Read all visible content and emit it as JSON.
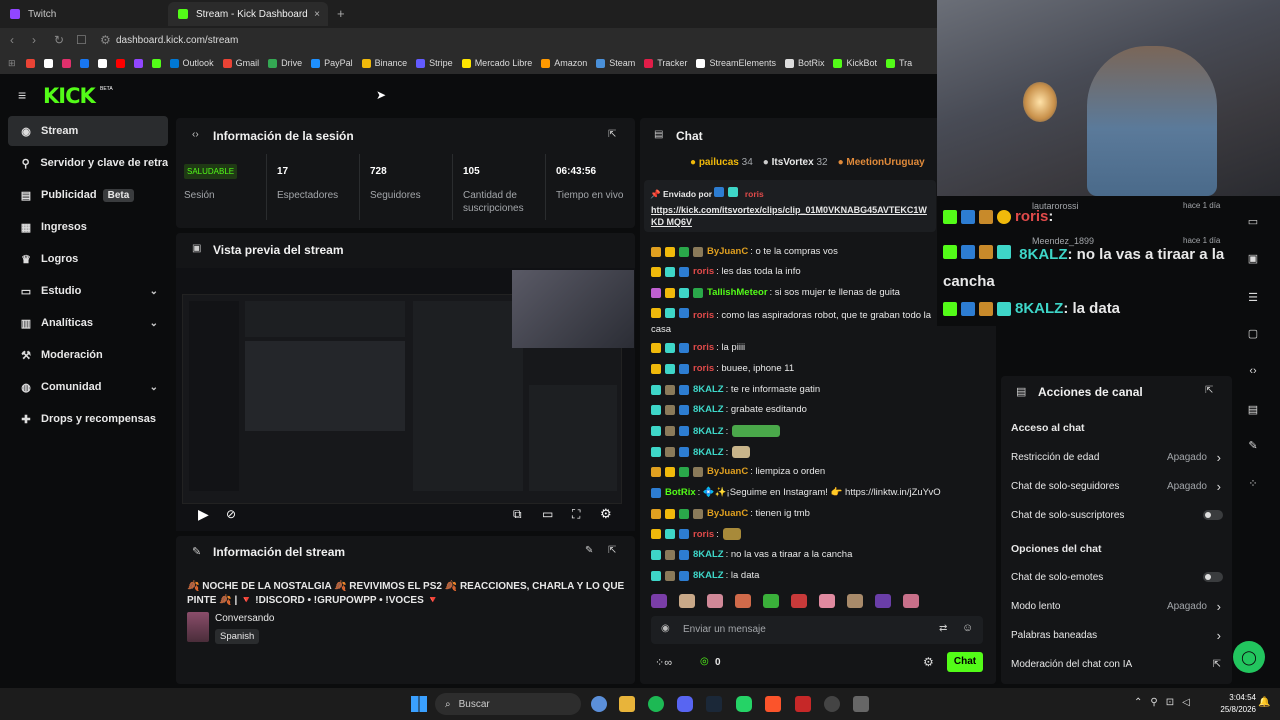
{
  "browser": {
    "tabs": [
      {
        "label": "Twitch",
        "color": "#9146ff"
      },
      {
        "label": "Stream - Kick Dashboard",
        "color": "#53fc18"
      }
    ],
    "new_tab": "+",
    "close": "×",
    "url": "dashboard.kick.com/stream",
    "bookmarks": [
      {
        "label": "",
        "color": "#ea4335"
      },
      {
        "label": "",
        "color": "#ffffff"
      },
      {
        "label": "",
        "color": "#e1306c"
      },
      {
        "label": "",
        "color": "#1877f2"
      },
      {
        "label": "",
        "color": "#ffffff"
      },
      {
        "label": "",
        "color": "#ff0000"
      },
      {
        "label": "",
        "color": "#9146ff"
      },
      {
        "label": "",
        "color": "#53fc18"
      },
      {
        "label": "Outlook",
        "color": "#0078d4"
      },
      {
        "label": "Gmail",
        "color": "#ea4335"
      },
      {
        "label": "Drive",
        "color": "#34a853"
      },
      {
        "label": "PayPal",
        "color": "#1e90ff"
      },
      {
        "label": "Binance",
        "color": "#f0b90b"
      },
      {
        "label": "Stripe",
        "color": "#635bff"
      },
      {
        "label": "Mercado Libre",
        "color": "#ffe600"
      },
      {
        "label": "Amazon",
        "color": "#ff9900"
      },
      {
        "label": "Steam",
        "color": "#4a90d9"
      },
      {
        "label": "Tracker",
        "color": "#e11d48"
      },
      {
        "label": "StreamElements",
        "color": "#ffffff"
      },
      {
        "label": "BotRix",
        "color": "#dddddd"
      },
      {
        "label": "KickBot",
        "color": "#53fc18"
      },
      {
        "label": "Tra",
        "color": "#53fc18"
      }
    ]
  },
  "brand": {
    "logo": "KICK",
    "beta": "BETA",
    "accent": "#53fc18"
  },
  "sidebar": {
    "items": [
      {
        "label": "Stream",
        "icon": "broadcast-icon"
      },
      {
        "label": "Servidor y clave de retran",
        "icon": "key-icon"
      },
      {
        "label": "Publicidad",
        "icon": "ad-icon",
        "badge": "Beta"
      },
      {
        "label": "Ingresos",
        "icon": "money-icon"
      },
      {
        "label": "Logros",
        "icon": "trophy-icon"
      },
      {
        "label": "Estudio",
        "icon": "studio-icon"
      },
      {
        "label": "Analíticas",
        "icon": "chart-icon"
      },
      {
        "label": "Moderación",
        "icon": "hammer-icon"
      },
      {
        "label": "Comunidad",
        "icon": "community-icon"
      },
      {
        "label": "Drops y recompensas",
        "icon": "gift-icon"
      }
    ]
  },
  "session": {
    "title": "Información de la sesión",
    "status": "SALUDABLE",
    "status_label": "Sesión",
    "stats": [
      {
        "value": "17",
        "label": "Espectadores"
      },
      {
        "value": "728",
        "label": "Seguidores"
      },
      {
        "value": "105",
        "label": "Cantidad de suscripciones"
      },
      {
        "value": "06:43:56",
        "label": "Tiempo en vivo"
      }
    ]
  },
  "preview": {
    "title": "Vista previa del stream"
  },
  "stream_info": {
    "title": "Información del stream",
    "stream_title": "🍂 NOCHE DE LA NOSTALGIA 🍂 REVIVIMOS EL PS2 🍂 REACCIONES, CHARLA Y LO QUE PINTE 🍂 | 🔻 !DISCORD • !GRUPOWPP • !VOCES 🔻",
    "category": "Conversando",
    "language": "Spanish"
  },
  "chat": {
    "title": "Chat",
    "gifters": [
      {
        "name": "pailucas",
        "count": "34"
      },
      {
        "name": "ItsVortex",
        "count": "32"
      },
      {
        "name": "MeetionUruguay",
        "count": ""
      }
    ],
    "pinned_by": "Enviado por",
    "pinned_user": "roris",
    "pinned_link": "https://kick.com/itsvortex/clips/clip_01M0VKNABG45AVTEKC1WKD MQ6V",
    "messages": [
      {
        "user": "ByJuanC",
        "color": "#e0a020",
        "text": ": o te la compras vos"
      },
      {
        "user": "roris",
        "color": "#e04a4a",
        "text": ": les das toda la info"
      },
      {
        "user": "TallishMeteor",
        "color": "#53fc18",
        "text": ": si sos mujer te llenas de guita"
      },
      {
        "user": "roris",
        "color": "#e04a4a",
        "text": ": como las aspiradoras robot, que te graban todo la casa"
      },
      {
        "user": "roris",
        "color": "#e04a4a",
        "text": ": la piiii"
      },
      {
        "user": "roris",
        "color": "#e04a4a",
        "text": ": buuee, iphone 11"
      },
      {
        "user": "8KALZ",
        "color": "#3ed6c8",
        "text": ": te re informaste gatin"
      },
      {
        "user": "8KALZ",
        "color": "#3ed6c8",
        "text": ": grabate esditando"
      },
      {
        "user": "8KALZ",
        "color": "#3ed6c8",
        "text": ":"
      },
      {
        "user": "8KALZ",
        "color": "#3ed6c8",
        "text": ":"
      },
      {
        "user": "ByJuanC",
        "color": "#e0a020",
        "text": ": liempiza o orden"
      },
      {
        "user": "BotRix",
        "color": "#53fc18",
        "text": ": 💠✨¡Seguime en Instagram! 👉 https://linktw.in/jZuYvO"
      },
      {
        "user": "ByJuanC",
        "color": "#e0a020",
        "text": ": tienen ig tmb"
      },
      {
        "user": "roris",
        "color": "#e04a4a",
        "text": ":"
      },
      {
        "user": "8KALZ",
        "color": "#3ed6c8",
        "text": ": no la vas a tiraar a la cancha"
      },
      {
        "user": "8KALZ",
        "color": "#3ed6c8",
        "text": ": la data"
      }
    ],
    "input_placeholder": "Enviar un mensaje",
    "points": "0",
    "send_label": "Chat"
  },
  "overlay": {
    "lines": [
      {
        "user": "roris",
        "text": ":"
      },
      {
        "user": "8KALZ",
        "text": ": no la vas a tiraar a la cancha"
      },
      {
        "user": "8KALZ",
        "text": ": la data"
      }
    ],
    "followers": [
      {
        "name": "lautarorossi",
        "ago": "hace 1 día"
      },
      {
        "name": "Meendez_1899",
        "ago": "hace 1 día"
      }
    ]
  },
  "channel_actions": {
    "title": "Acciones de canal",
    "section_chat_access": "Acceso al chat",
    "rows_access": [
      {
        "label": "Restricción de edad",
        "value": "Apagado",
        "type": "chevron"
      },
      {
        "label": "Chat de solo-seguidores",
        "value": "Apagado",
        "type": "chevron"
      },
      {
        "label": "Chat de solo-suscriptores",
        "value": "",
        "type": "toggle"
      }
    ],
    "section_chat_options": "Opciones del chat",
    "rows_options": [
      {
        "label": "Chat de solo-emotes",
        "value": "",
        "type": "toggle"
      },
      {
        "label": "Modo lento",
        "value": "Apagado",
        "type": "chevron"
      },
      {
        "label": "Palabras baneadas",
        "value": "",
        "type": "chevron"
      },
      {
        "label": "Moderación del chat con IA",
        "value": "",
        "type": "external"
      }
    ]
  },
  "taskbar": {
    "search": "Buscar",
    "time": "3:04:54",
    "date": "25/8/2026"
  }
}
